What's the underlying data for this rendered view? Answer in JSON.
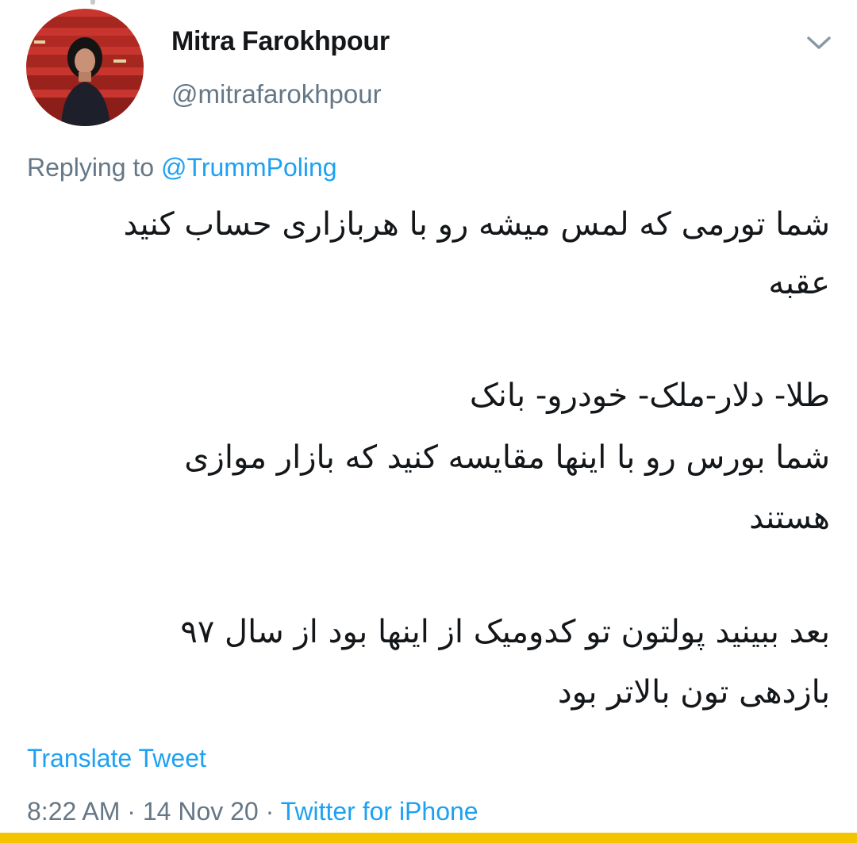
{
  "author": {
    "display_name": "Mitra Farokhpour",
    "handle": "@mitrafarokhpour"
  },
  "reply": {
    "prefix": "Replying to ",
    "mention": "@TrummPoling"
  },
  "tweet_lines": [
    "شما تورمی که لمس میشه رو با هربازاری حساب کنید",
    "عقبه",
    "طلا- دلار-ملک- خودرو- بانک",
    "شما بورس رو با اینها مقایسه کنید که بازار موازی",
    "هستند",
    "بعد ببینید پولتون تو کدومیک از اینها بود از سال ۹۷",
    "بازدهی تون بالاتر بود"
  ],
  "translate_label": "Translate Tweet",
  "meta": {
    "time": "8:22 AM",
    "separator": " · ",
    "date": "14 Nov 20",
    "source": "Twitter for iPhone"
  },
  "colors": {
    "accent": "#1da1f2",
    "secondary_text": "#657786",
    "primary_text": "#14171a",
    "bottom_bar": "#f5c400"
  },
  "icons": {
    "menu": "chevron-down-icon"
  }
}
